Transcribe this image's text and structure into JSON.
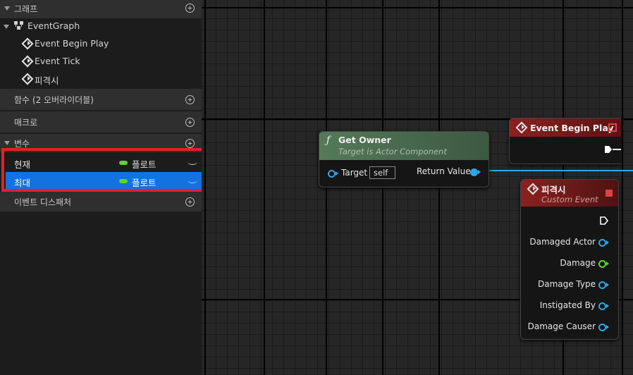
{
  "panel": {
    "sections": {
      "graphs": {
        "label": "그래프"
      },
      "functions": {
        "label": "함수 (2 오버라이더블)"
      },
      "macros": {
        "label": "매크로"
      },
      "variables": {
        "label": "변수"
      },
      "dispatchers": {
        "label": "이벤트 디스패처"
      }
    },
    "event_graph": {
      "label": "EventGraph"
    },
    "events": [
      {
        "label": "Event Begin Play"
      },
      {
        "label": "Event Tick"
      },
      {
        "label": "피격시"
      }
    ],
    "variables": [
      {
        "name": "현재",
        "type": "플로트",
        "selected": false
      },
      {
        "name": "최대",
        "type": "플로트",
        "selected": true
      }
    ],
    "colors": {
      "float_pin": "#5cd42c",
      "selection": "#1272e0",
      "highlight": "#e42028"
    }
  },
  "graph": {
    "get_owner": {
      "title": "Get Owner",
      "subtitle": "Target is Actor Component",
      "target_label": "Target",
      "target_value": "self",
      "return_label": "Return Value",
      "icon": "function-icon",
      "header_color": "#4b6b4a"
    },
    "begin_play": {
      "title": "Event Begin Play",
      "header_color": "#7c1d1d"
    },
    "on_damaged": {
      "title": "피격시",
      "subtitle": "Custom Event",
      "header_color": "#7c1d1d",
      "outputs": [
        {
          "label": "Damaged Actor",
          "color": "blue"
        },
        {
          "label": "Damage",
          "color": "green"
        },
        {
          "label": "Damage Type",
          "color": "blue"
        },
        {
          "label": "Instigated By",
          "color": "blue"
        },
        {
          "label": "Damage Causer",
          "color": "blue"
        }
      ]
    }
  }
}
